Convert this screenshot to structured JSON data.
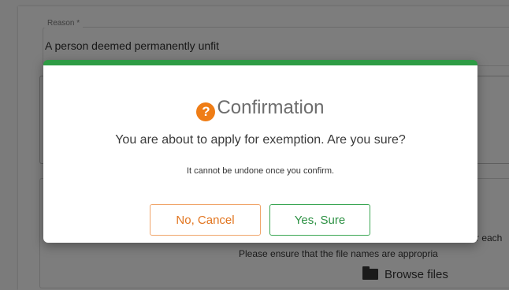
{
  "form": {
    "reason_label": "Reason *",
    "reason_value": "A person deemed permanently unfit",
    "upload_text_1": "r each",
    "upload_text_2": "Please ensure that the file names are appropria",
    "browse_label": "Browse files"
  },
  "dialog": {
    "title": "Confirmation",
    "message": "You are about to apply for exemption. Are you sure?",
    "submessage": "It cannot be undone once you confirm.",
    "cancel_label": "No, Cancel",
    "confirm_label": "Yes, Sure"
  },
  "colors": {
    "accent_green": "#2e9c45",
    "accent_orange": "#ef7d16"
  },
  "icons": {
    "question": "question-circle-icon",
    "folder": "folder-icon"
  }
}
